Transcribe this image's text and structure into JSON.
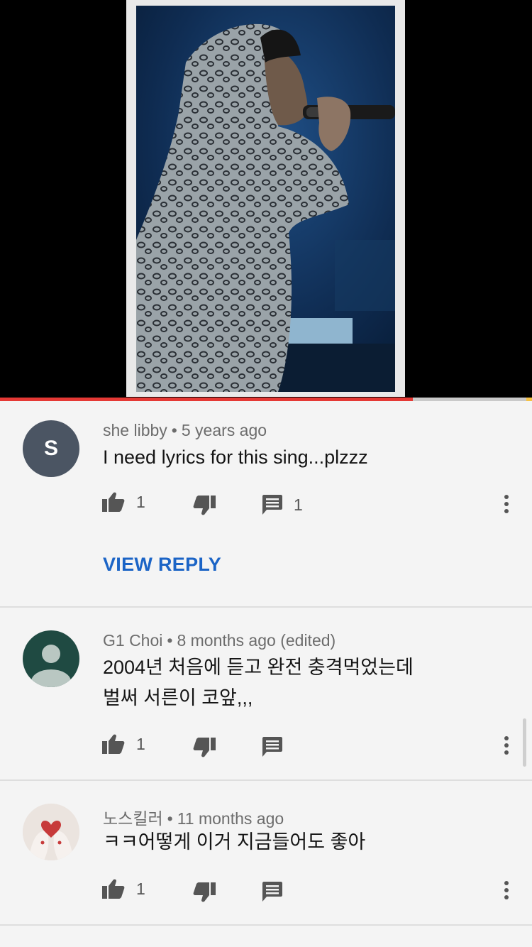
{
  "colors": {
    "progress_played": "#e53935",
    "link": "#1b64c6",
    "background": "#f4f4f4"
  },
  "video": {
    "progress_fraction": 0.776,
    "thumbnail": "performer-singing-into-microphone"
  },
  "comments": [
    {
      "author": "she libby",
      "time": "5 years ago",
      "text": "I need lyrics for this sing...plzzz",
      "avatar_letter": "S",
      "likes": "1",
      "replies_count": "1",
      "view_reply_label": "VIEW REPLY"
    },
    {
      "author": "G1 Choi",
      "time": "8 months ago (edited)",
      "text_line1": "2004년 처음에 듣고 완전 충격먹었는데",
      "text_line2": "벌써 서른이 코앞,,,",
      "likes": "1"
    },
    {
      "author": "노스킬러",
      "time": "11 months ago",
      "text": "ㅋㅋ어떻게 이거 지금들어도 좋아",
      "likes": "1"
    }
  ]
}
